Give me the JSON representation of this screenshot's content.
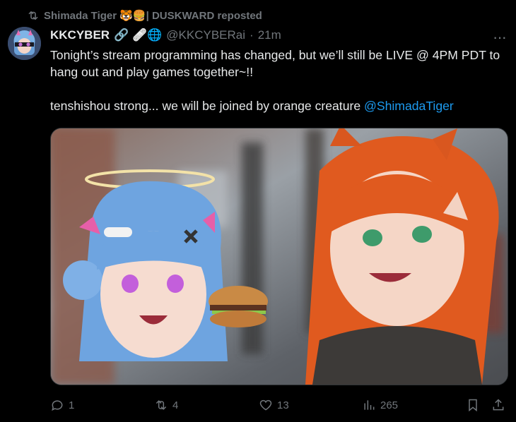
{
  "repost": {
    "text": "Shimada Tiger 🐯🍔| DUSKWARD reposted"
  },
  "tweet": {
    "name": "KKCYBER",
    "name_decor": "🔗 🩹🌐",
    "handle": "@KKCYBERai",
    "dot": "·",
    "time": "21m",
    "more": "···",
    "line1": "Tonight’s stream programming has changed, but we’ll still be LIVE @ 4PM PDT to hang out and play games together~!!",
    "line2_prefix": "tenshishou strong... we will be joined by orange creature ",
    "mention": "@ShimadaTiger"
  },
  "actions": {
    "replies": "1",
    "reposts": "4",
    "likes": "13",
    "views": "265"
  },
  "colors": {
    "accent": "#1d9bf0",
    "muted": "#71767b",
    "text": "#e7e9ea",
    "bg": "#000000"
  }
}
